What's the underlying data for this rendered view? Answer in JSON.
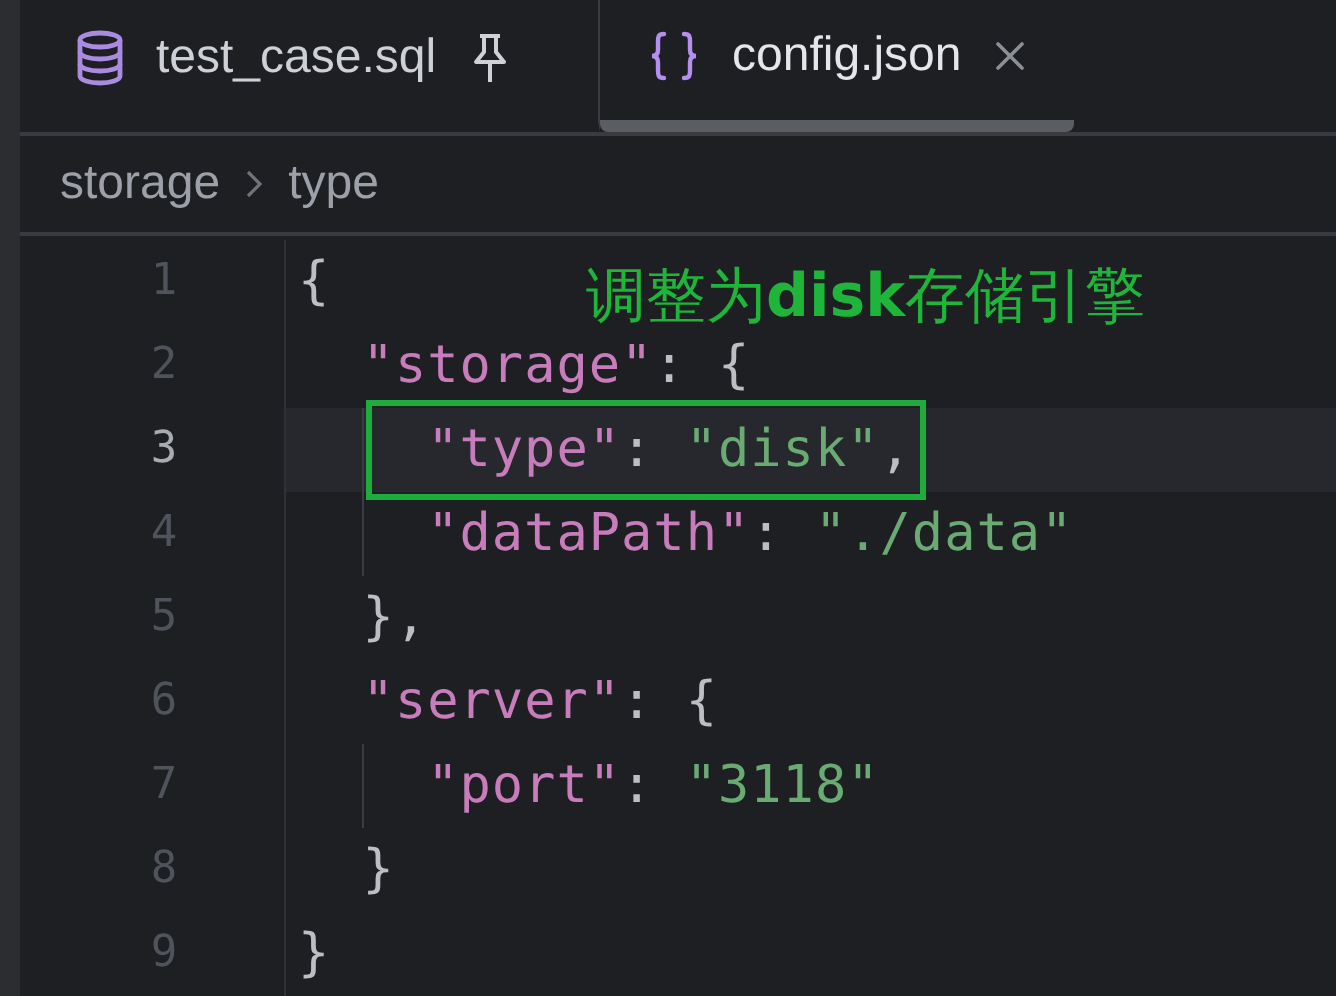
{
  "tabs": [
    {
      "label": "test_case.sql",
      "pinned": true,
      "selected": false
    },
    {
      "label": "config.json",
      "pinned": false,
      "selected": true
    }
  ],
  "breadcrumb": [
    "storage",
    "type"
  ],
  "editor": {
    "lines": [
      {
        "number": "1",
        "current": false,
        "boxed": false,
        "tokens": [
          {
            "kind": "punct",
            "text": "{"
          }
        ],
        "children": [
          {
            "number": "2",
            "current": false,
            "boxed": false,
            "tokens": [
              {
                "kind": "key",
                "text": "\"storage\""
              },
              {
                "kind": "punct",
                "text": ": {"
              }
            ],
            "children": [
              {
                "number": "3",
                "current": true,
                "boxed": true,
                "tokens": [
                  {
                    "kind": "key",
                    "text": "\"type\""
                  },
                  {
                    "kind": "punct",
                    "text": ": "
                  },
                  {
                    "kind": "string",
                    "text": "\"disk\""
                  },
                  {
                    "kind": "punct",
                    "text": ","
                  }
                ]
              },
              {
                "number": "4",
                "current": false,
                "boxed": false,
                "tokens": [
                  {
                    "kind": "key",
                    "text": "\"dataPath\""
                  },
                  {
                    "kind": "punct",
                    "text": ": "
                  },
                  {
                    "kind": "string",
                    "text": "\"./data\""
                  }
                ]
              }
            ]
          },
          {
            "number": "5",
            "current": false,
            "boxed": false,
            "tokens": [
              {
                "kind": "punct",
                "text": "},"
              }
            ]
          },
          {
            "number": "6",
            "current": false,
            "boxed": false,
            "tokens": [
              {
                "kind": "key",
                "text": "\"server\""
              },
              {
                "kind": "punct",
                "text": ": {"
              }
            ],
            "children": [
              {
                "number": "7",
                "current": false,
                "boxed": false,
                "tokens": [
                  {
                    "kind": "key",
                    "text": "\"port\""
                  },
                  {
                    "kind": "punct",
                    "text": ": "
                  },
                  {
                    "kind": "string",
                    "text": "\"3118\""
                  }
                ]
              }
            ]
          },
          {
            "number": "8",
            "current": false,
            "boxed": false,
            "tokens": [
              {
                "kind": "punct",
                "text": "}"
              }
            ]
          }
        ]
      },
      {
        "number": "9",
        "current": false,
        "boxed": false,
        "tokens": [
          {
            "kind": "punct",
            "text": "}"
          }
        ]
      }
    ],
    "annotation": "调整为**disk**存储引擎"
  }
}
